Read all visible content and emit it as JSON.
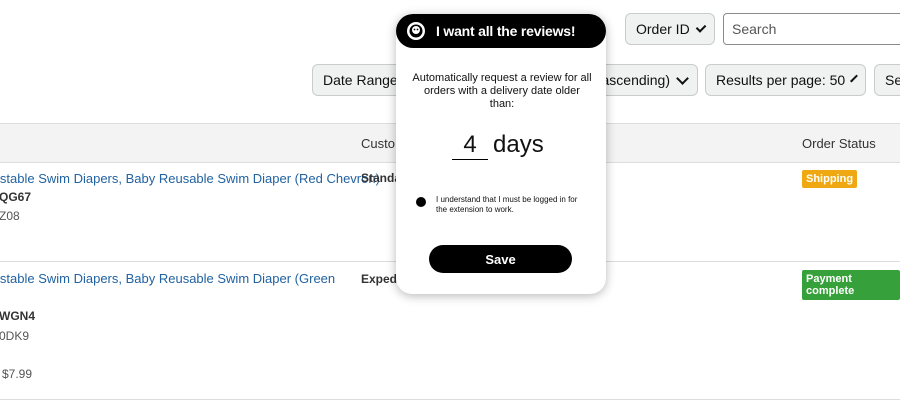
{
  "toolbar": {
    "order_id_label": "Order ID",
    "search_placeholder": "Search",
    "date_range_label": "Date Range:",
    "sort_partial": "ascending)",
    "results_per_page_label": "Results per page: 50",
    "more_partial": "Se"
  },
  "table": {
    "headers": {
      "customer": "Custo",
      "order_status": "Order Status"
    },
    "rows": [
      {
        "product_title": "istable Swim Diapers, Baby Reusable Swim Diaper (Red Chevron)",
        "code1": "QG67",
        "code2": "Z08",
        "shipping": "Standa",
        "status": "Shipping",
        "status_color": "#f0a812"
      },
      {
        "product_title": "istable Swim Diapers, Baby Reusable Swim Diaper (Green",
        "code1": "WGN4",
        "code2": "0DK9",
        "price": "$7.99",
        "shipping": "Exped",
        "status": "Payment complete",
        "status_color": "#36a13a"
      }
    ]
  },
  "popup": {
    "title": "I want all the reviews!",
    "description": "Automatically request a review for all orders with a delivery date older than:",
    "days_value": "4",
    "days_unit": "days",
    "consent_text": "I understand that I must be logged in for the extension to work.",
    "save_label": "Save",
    "logo_icon": "reviewer-face-icon"
  }
}
